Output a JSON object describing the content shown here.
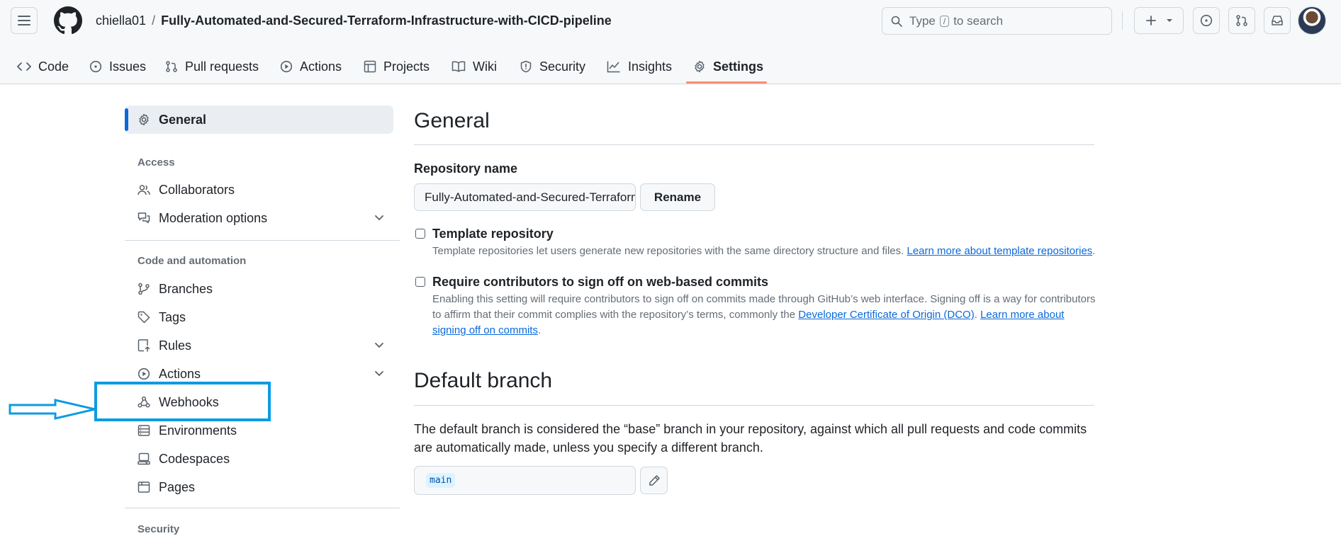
{
  "header": {
    "owner": "chiella01",
    "separator": "/",
    "repo": "Fully-Automated-and-Secured-Terraform-Infrastructure-with-CICD-pipeline",
    "search": {
      "prefix": "Type",
      "slash": "/",
      "suffix": "to search"
    },
    "icons": [
      "hamburger-icon",
      "github-logo",
      "plus-icon",
      "issue-icon",
      "pull-request-icon",
      "inbox-icon"
    ]
  },
  "tabs": [
    {
      "label": "Code",
      "icon": "code-icon"
    },
    {
      "label": "Issues",
      "icon": "issue-icon"
    },
    {
      "label": "Pull requests",
      "icon": "pull-request-icon"
    },
    {
      "label": "Actions",
      "icon": "play-icon"
    },
    {
      "label": "Projects",
      "icon": "table-icon"
    },
    {
      "label": "Wiki",
      "icon": "book-icon"
    },
    {
      "label": "Security",
      "icon": "shield-icon"
    },
    {
      "label": "Insights",
      "icon": "graph-icon"
    },
    {
      "label": "Settings",
      "icon": "gear-icon",
      "active": true
    }
  ],
  "sidebar": {
    "general": "General",
    "access_heading": "Access",
    "collaborators": "Collaborators",
    "moderation": "Moderation options",
    "code_heading": "Code and automation",
    "branches": "Branches",
    "tags": "Tags",
    "rules": "Rules",
    "actions": "Actions",
    "webhooks": "Webhooks",
    "environments": "Environments",
    "codespaces": "Codespaces",
    "pages": "Pages",
    "security_heading": "Security"
  },
  "main": {
    "title": "General",
    "repo_name_label": "Repository name",
    "repo_name_value": "Fully-Automated-and-Secured-Terraform-Infrastructure-with-CICD-pipeline",
    "rename_label": "Rename",
    "template": {
      "title": "Template repository",
      "desc": "Template repositories let users generate new repositories with the same directory structure and files.",
      "link": "Learn more about template repositories",
      "end": "."
    },
    "signoff": {
      "title": "Require contributors to sign off on web-based commits",
      "desc": "Enabling this setting will require contributors to sign off on commits made through GitHub’s web interface. Signing off is a way for contributors to affirm that their commit complies with the repository’s terms, commonly the",
      "link1": "Developer Certificate of Origin (DCO)",
      "mid": ".",
      "link2": "Learn more about signing off on commits",
      "end": "."
    },
    "default_branch_title": "Default branch",
    "default_branch_desc": "The default branch is considered the “base” branch in your repository, against which all pull requests and code commits are automatically made, unless you specify a different branch.",
    "default_branch_value": "main"
  },
  "colors": {
    "accent": "#0969da",
    "active_tab_underline": "#fd8c73",
    "annotation": "#0b9be2"
  }
}
